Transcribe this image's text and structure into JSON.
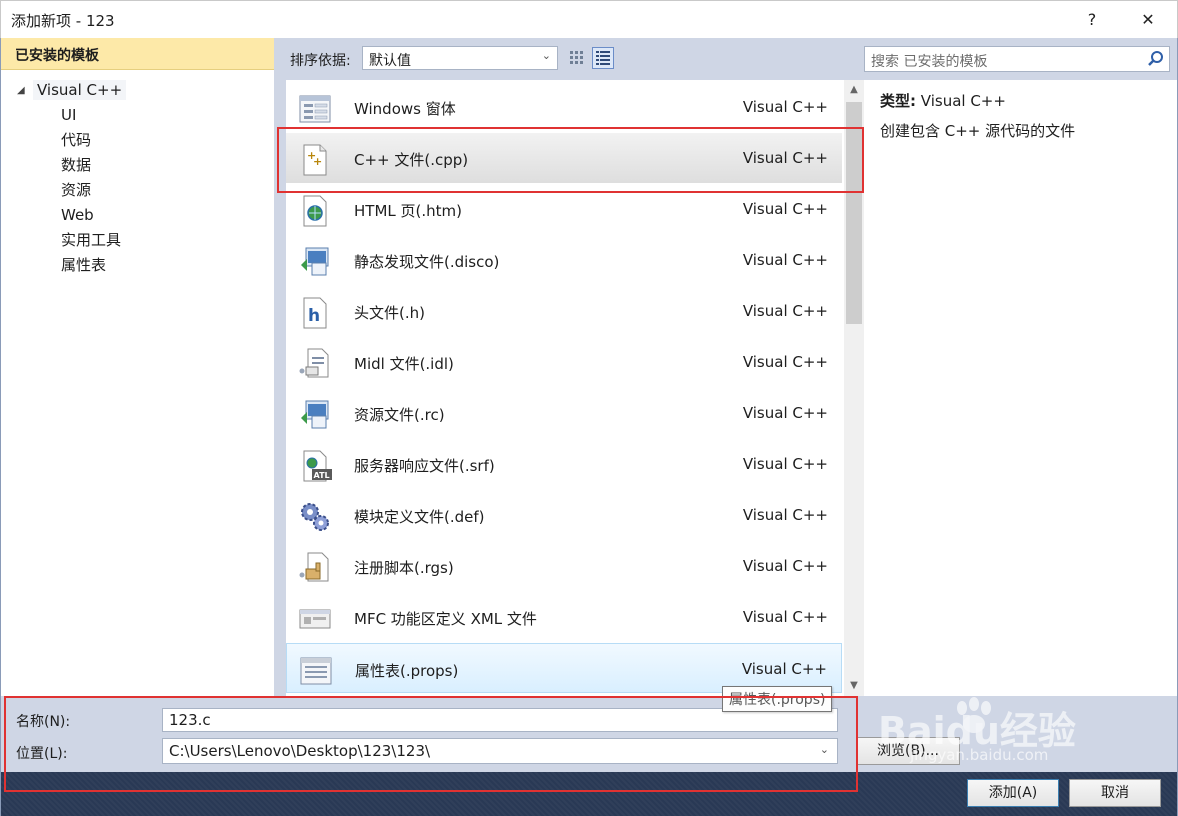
{
  "window": {
    "title": "添加新项 - 123",
    "help_label": "?",
    "close_label": "✕"
  },
  "sidebar": {
    "header": "已安装的模板",
    "root": "Visual C++",
    "children": [
      "UI",
      "代码",
      "数据",
      "资源",
      "Web",
      "实用工具",
      "属性表"
    ]
  },
  "toolbar": {
    "sort_label": "排序依据:",
    "sort_value": "默认值"
  },
  "search": {
    "placeholder": "搜索 已安装的模板"
  },
  "templates": [
    {
      "name": "Windows 窗体",
      "lang": "Visual C++",
      "icon": "form-icon"
    },
    {
      "name": "C++ 文件(.cpp)",
      "lang": "Visual C++",
      "icon": "cpp-file-icon"
    },
    {
      "name": "HTML 页(.htm)",
      "lang": "Visual C++",
      "icon": "html-page-icon"
    },
    {
      "name": "静态发现文件(.disco)",
      "lang": "Visual C++",
      "icon": "disco-file-icon"
    },
    {
      "name": "头文件(.h)",
      "lang": "Visual C++",
      "icon": "header-file-icon"
    },
    {
      "name": "Midl 文件(.idl)",
      "lang": "Visual C++",
      "icon": "idl-file-icon"
    },
    {
      "name": "资源文件(.rc)",
      "lang": "Visual C++",
      "icon": "resource-file-icon"
    },
    {
      "name": "服务器响应文件(.srf)",
      "lang": "Visual C++",
      "icon": "srf-file-icon"
    },
    {
      "name": "模块定义文件(.def)",
      "lang": "Visual C++",
      "icon": "def-file-icon"
    },
    {
      "name": "注册脚本(.rgs)",
      "lang": "Visual C++",
      "icon": "rgs-file-icon"
    },
    {
      "name": "MFC 功能区定义 XML 文件",
      "lang": "Visual C++",
      "icon": "mfc-ribbon-icon"
    },
    {
      "name": "属性表(.props)",
      "lang": "Visual C++",
      "icon": "props-file-icon"
    }
  ],
  "details": {
    "type_label": "类型:",
    "type_value": "Visual C++",
    "description": "创建包含 C++ 源代码的文件"
  },
  "tooltip": "属性表(.props)",
  "form": {
    "name_label": "名称(N):",
    "name_value": "123.c",
    "location_label": "位置(L):",
    "location_value": "C:\\Users\\Lenovo\\Desktop\\123\\123\\",
    "browse_label": "浏览(B)...",
    "add_label": "添加(A)",
    "cancel_label": "取消"
  },
  "watermark": {
    "brand": "Baidu经验",
    "url": "jingyan.baidu.com"
  },
  "colors": {
    "highlight": "#e03232",
    "frame": "#cfd6e5",
    "header_gold": "#fde9a8"
  }
}
